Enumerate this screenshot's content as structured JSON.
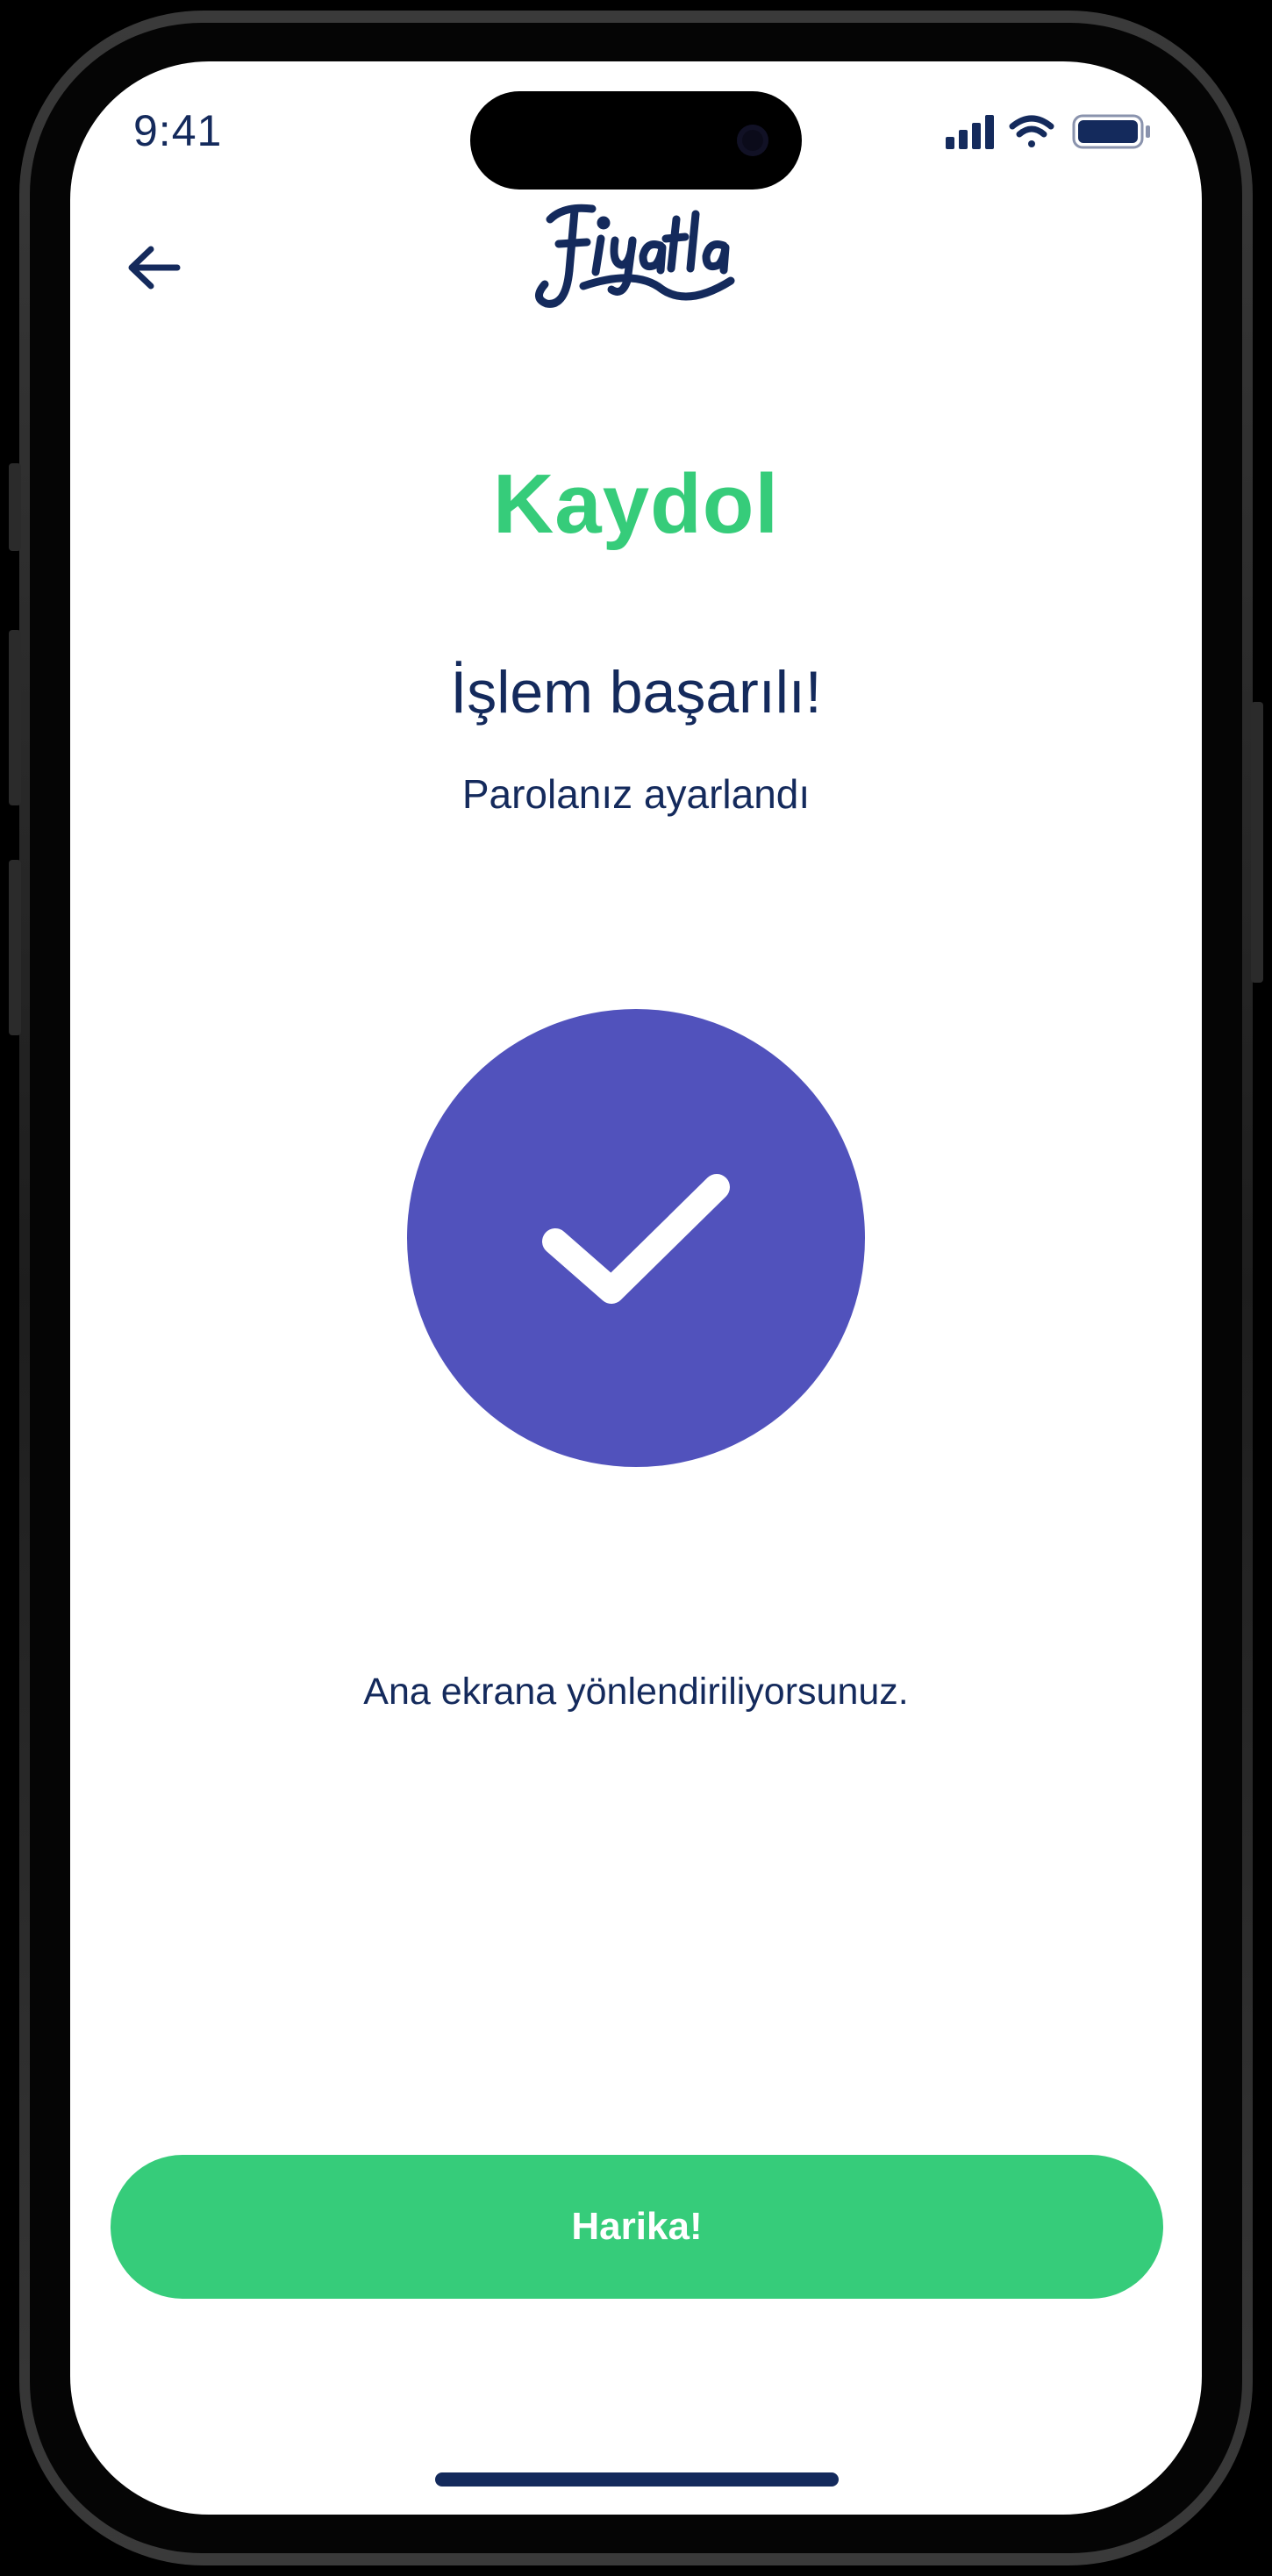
{
  "status_bar": {
    "time": "9:41",
    "icons": [
      "cellular-signal-icon",
      "wifi-icon",
      "battery-icon"
    ]
  },
  "header": {
    "back_icon": "arrow-left-icon",
    "logo_text": "Fiyatla"
  },
  "main": {
    "title": "Kaydol",
    "headline": "İşlem başarılı!",
    "subtitle": "Parolanız ayarlandı",
    "status_icon": "checkmark-icon",
    "redirect_text": "Ana ekrana yönlendiriliyorsunuz."
  },
  "footer": {
    "button_label": "Harika!"
  },
  "colors": {
    "brand_green": "#36cc7a",
    "navy_text": "#142a5c",
    "success_purple": "#5152bc",
    "background": "#ffffff"
  }
}
